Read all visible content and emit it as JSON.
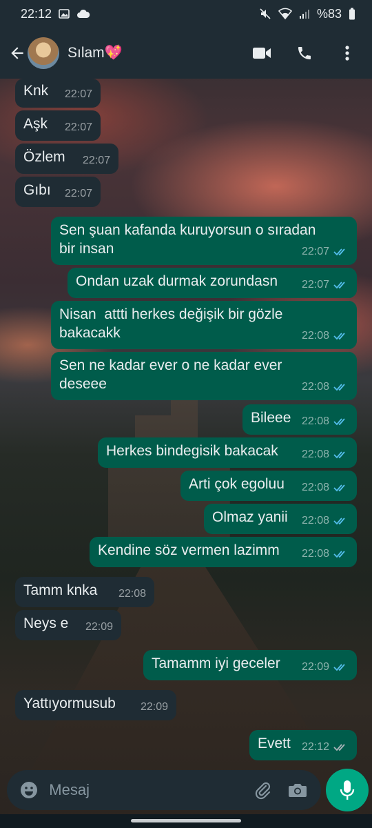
{
  "status_bar": {
    "time": "22:12",
    "battery": "%83"
  },
  "header": {
    "contact_name": "Sılam💖"
  },
  "colors": {
    "accent": "#00a884",
    "outgoing_bubble": "#005c4b",
    "incoming_bubble": "#1f2c34",
    "read_ticks": "#53bdeb"
  },
  "messages": [
    {
      "dir": "in",
      "text": "Knk",
      "time": "22:07"
    },
    {
      "dir": "in",
      "text": "Aşk",
      "time": "22:07"
    },
    {
      "dir": "in",
      "text": "Özlem",
      "time": "22:07"
    },
    {
      "dir": "in",
      "text": "Gıbı",
      "time": "22:07"
    },
    {
      "dir": "out",
      "text": "Sen şuan kafanda kuruyorsun o sıradan\nbir insan",
      "time": "22:07"
    },
    {
      "dir": "out",
      "text": "Ondan uzak durmak zorundasn",
      "time": "22:07"
    },
    {
      "dir": "out",
      "text": "Nisan  attti herkes değişik bir gözle\nbakacakk",
      "time": "22:08"
    },
    {
      "dir": "out",
      "text": "Sen ne kadar ever o ne kadar ever\ndeseee",
      "time": "22:08"
    },
    {
      "dir": "out",
      "text": "Bileee",
      "time": "22:08"
    },
    {
      "dir": "out",
      "text": "Herkes bindegisik bakacak",
      "time": "22:08"
    },
    {
      "dir": "out",
      "text": "Arti çok egoluu",
      "time": "22:08"
    },
    {
      "dir": "out",
      "text": "Olmaz yanii",
      "time": "22:08"
    },
    {
      "dir": "out",
      "text": "Kendine söz vermen lazimm",
      "time": "22:08"
    },
    {
      "dir": "in",
      "text": "Tamm knka",
      "time": "22:08"
    },
    {
      "dir": "in",
      "text": "Neys e",
      "time": "22:09"
    },
    {
      "dir": "out",
      "text": "Tamamm iyi geceler",
      "time": "22:09"
    },
    {
      "dir": "in",
      "text": "Yattıyormusub",
      "time": "22:09"
    },
    {
      "dir": "out",
      "text": "Evett",
      "time": "22:12"
    }
  ],
  "composer": {
    "placeholder": "Mesaj"
  },
  "icons": {
    "back": "arrow-left-icon",
    "video": "video-call-icon",
    "call": "phone-icon",
    "menu": "more-vertical-icon",
    "emoji": "emoji-icon",
    "attach": "paperclip-icon",
    "camera": "camera-icon",
    "mic": "microphone-icon"
  }
}
